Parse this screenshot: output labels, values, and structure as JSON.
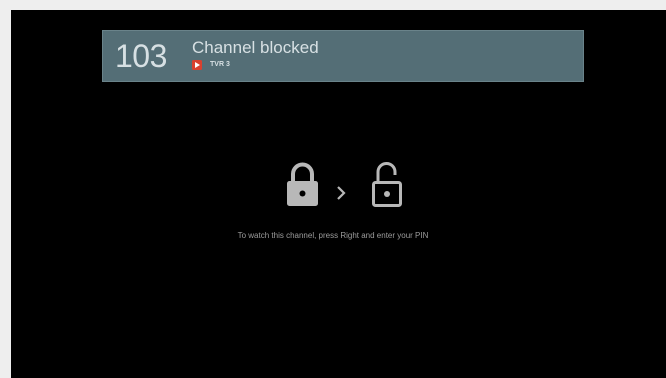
{
  "banner": {
    "channel_number": "103",
    "title": "Channel blocked",
    "channel_name": "TVR 3"
  },
  "icons": {
    "locked": "lock-closed-icon",
    "arrow": "chevron-right-icon",
    "unlocked": "lock-open-icon",
    "source": "play-icon"
  },
  "message": "To watch this channel, press Right and enter your PIN",
  "colors": {
    "banner_background": "#546e76",
    "banner_text": "#d7e0e3",
    "screen_background": "#000000",
    "frame_background": "#eeeeee",
    "icon_color": "#b8b8b8",
    "message_text": "#9c9c9c",
    "play_icon": "#d8412f"
  }
}
